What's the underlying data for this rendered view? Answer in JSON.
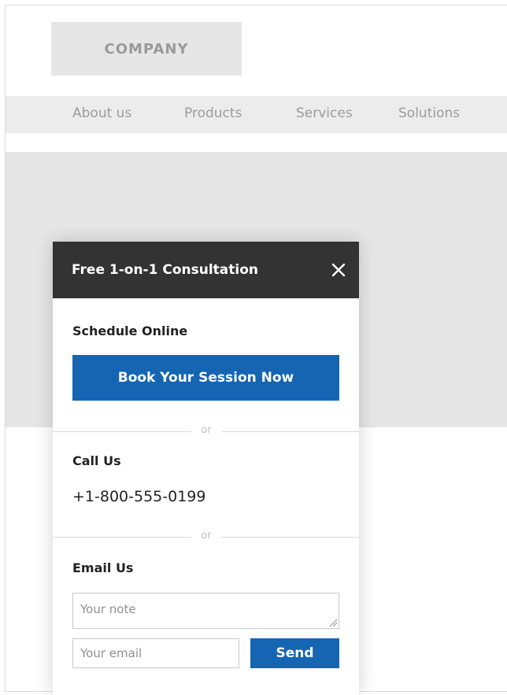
{
  "logo": {
    "text": "COMPANY"
  },
  "nav": {
    "items": [
      {
        "label": "About us"
      },
      {
        "label": "Products"
      },
      {
        "label": "Services"
      },
      {
        "label": "Solutions"
      }
    ]
  },
  "modal": {
    "title": "Free 1-on-1 Consultation",
    "close_icon": "close-icon",
    "schedule": {
      "label": "Schedule Online",
      "button_label": "Book Your Session Now"
    },
    "divider_text": "or",
    "call": {
      "label": "Call Us",
      "phone": "+1-800-555-0199"
    },
    "email": {
      "label": "Email Us",
      "note_placeholder": "Your note",
      "note_value": "",
      "email_placeholder": "Your email",
      "email_value": "",
      "send_label": "Send"
    }
  },
  "colors": {
    "accent": "#1565b2",
    "header": "#333333",
    "placeholder_gray": "#e6e6e6"
  }
}
